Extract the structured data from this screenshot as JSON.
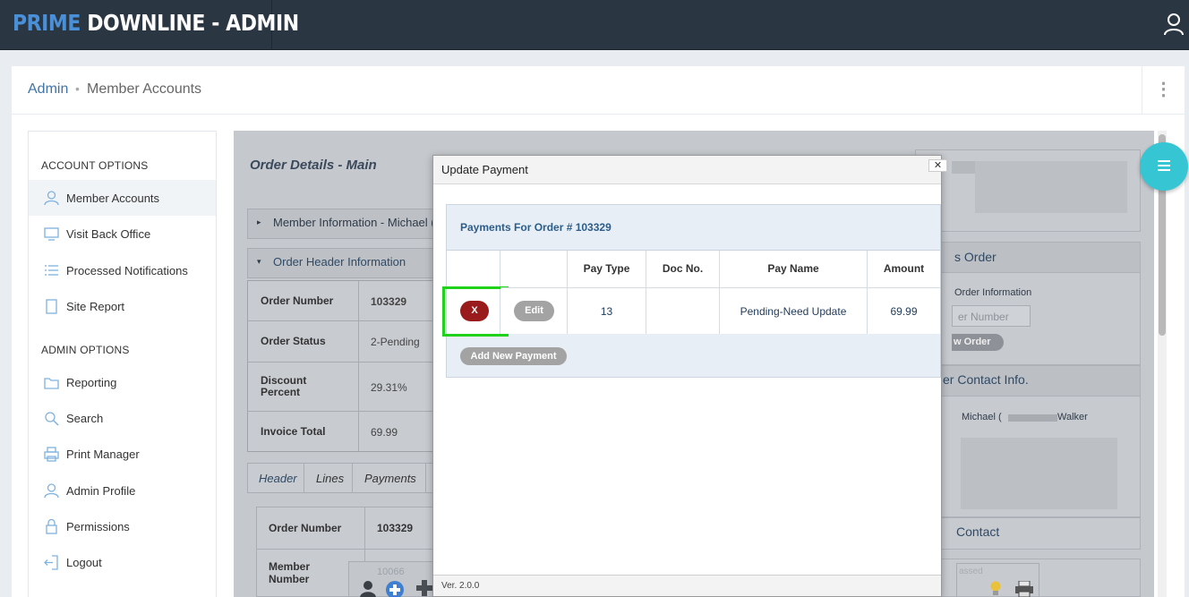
{
  "app": {
    "logo_part1": "PRIME",
    "logo_part2": "DOWNLINE - ADMIN"
  },
  "breadcrumb": {
    "root": "Admin",
    "separator": "•",
    "current": "Member Accounts"
  },
  "sidebar": {
    "section1_title": "ACCOUNT OPTIONS",
    "section2_title": "ADMIN OPTIONS",
    "items": [
      {
        "label": "Member Accounts",
        "icon": "user-icon",
        "active": true
      },
      {
        "label": "Visit Back Office",
        "icon": "monitor-icon"
      },
      {
        "label": "Processed Notifications",
        "icon": "list-icon"
      },
      {
        "label": "Site Report",
        "icon": "document-icon"
      },
      {
        "label": "Reporting",
        "icon": "folder-icon"
      },
      {
        "label": "Search",
        "icon": "search-icon"
      },
      {
        "label": "Print Manager",
        "icon": "printer-icon"
      },
      {
        "label": "Admin Profile",
        "icon": "user-icon"
      },
      {
        "label": "Permissions",
        "icon": "lock-icon"
      },
      {
        "label": "Logout",
        "icon": "logout-icon"
      }
    ]
  },
  "main": {
    "title": "Order Details - Main",
    "member_info_label": "Member Information - Michael (D",
    "order_header_label": "Order Header Information",
    "order_fields": [
      {
        "label": "Order Number",
        "value": "103329"
      },
      {
        "label": "Order Status",
        "value": "2-Pending"
      },
      {
        "label": "Discount Percent",
        "value": "29.31%"
      },
      {
        "label": "Invoice Total",
        "value": "69.99"
      }
    ],
    "tabs": [
      "Header",
      "Lines",
      "Payments"
    ],
    "detail_rows": [
      {
        "label": "Order Number",
        "value": "103329"
      },
      {
        "label": "Member Number",
        "value": "10066"
      }
    ]
  },
  "right_panels": {
    "order_title": "s Order",
    "order_info": "Order Information",
    "order_number_placeholder": "er Number",
    "view_order_label": "w Order",
    "contact_title": "er Contact Info.",
    "contact_name_first": "Michael (",
    "contact_name_last": "Walker",
    "contact2_title": "Contact",
    "lower_text": "assed"
  },
  "modal": {
    "title": "Update Payment",
    "close_label": "✕",
    "subtitle": "Payments For Order # 103329",
    "columns": [
      "",
      "",
      "Pay Type",
      "Doc No.",
      "Pay Name",
      "Amount"
    ],
    "rows": [
      {
        "delete_label": "X",
        "edit_label": "Edit",
        "pay_type": "13",
        "doc_no": "",
        "pay_name": "Pending-Need Update",
        "amount": "69.99"
      }
    ],
    "add_button": "Add New Payment",
    "version": "Ver. 2.0.0"
  },
  "colors": {
    "topbar": "#2b3643",
    "logo_accent": "#4a90d9",
    "fab": "#36c6d3",
    "delete_button": "#9a1b1b",
    "highlight": "#20d21a"
  }
}
